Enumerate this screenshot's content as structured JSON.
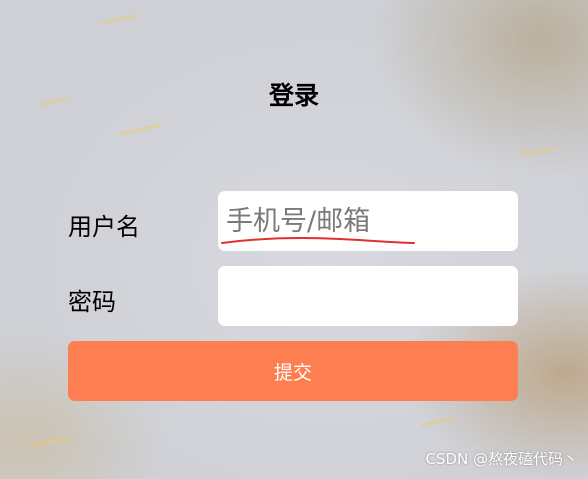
{
  "login": {
    "title": "登录",
    "username_label": "用户名",
    "username_placeholder": "手机号/邮箱",
    "username_value": "",
    "password_label": "密码",
    "password_value": "",
    "submit_label": "提交"
  },
  "watermark": "CSDN @熬夜磕代码丶",
  "colors": {
    "submit_button": "#fd7e50",
    "underline": "#e03030"
  }
}
